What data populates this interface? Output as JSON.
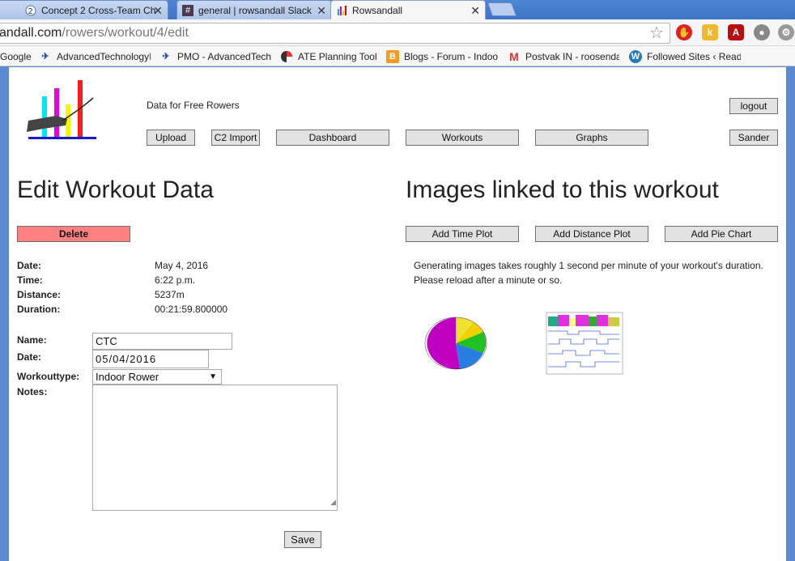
{
  "tabs": [
    {
      "label": "Concept 2 Cross-Team Ch",
      "icon": "concept2-icon",
      "active": false
    },
    {
      "label": "general | rowsandall Slack",
      "icon": "slack-icon",
      "active": false
    },
    {
      "label": "Rowsandall",
      "icon": "chart-favicon-icon",
      "active": true
    }
  ],
  "address": {
    "domain": "andall.com",
    "path": "/rowers/workout/4/edit"
  },
  "bookmarks": [
    {
      "label": "Google",
      "icon": "google-icon"
    },
    {
      "label": "AdvancedTechnologyI",
      "icon": "bookmark-app-icon"
    },
    {
      "label": "PMO - AdvancedTech",
      "icon": "bookmark-app-icon"
    },
    {
      "label": "ATE Planning Tool",
      "icon": "planning-icon"
    },
    {
      "label": "Blogs - Forum - Indoo",
      "icon": "blogger-icon"
    },
    {
      "label": "Postvak IN - roosenda",
      "icon": "gmail-icon"
    },
    {
      "label": "Followed Sites ‹ Read",
      "icon": "wordpress-icon"
    }
  ],
  "header": {
    "tagline": "Data for Free Rowers",
    "logout": "logout",
    "user": "Sander",
    "nav": {
      "upload": "Upload",
      "c2import": "C2 Import",
      "dashboard": "Dashboard",
      "workouts": "Workouts",
      "graphs": "Graphs"
    }
  },
  "edit": {
    "title": "Edit Workout Data",
    "delete": "Delete",
    "summary": [
      {
        "label": "Date:",
        "value": "May 4, 2016"
      },
      {
        "label": "Time:",
        "value": "6:22 p.m."
      },
      {
        "label": "Distance:",
        "value": "5237m"
      },
      {
        "label": "Duration:",
        "value": "00:21:59.800000"
      }
    ],
    "form": {
      "name_label": "Name:",
      "name_value": "CTC",
      "date_label": "Date:",
      "date_value": "05/04/2016",
      "type_label": "Workouttype:",
      "type_value": "Indoor Rower",
      "notes_label": "Notes:",
      "notes_value": ""
    },
    "save": "Save"
  },
  "images": {
    "title": "Images linked to this workout",
    "buttons": {
      "time": "Add Time Plot",
      "distance": "Add Distance Plot",
      "pie": "Add Pie Chart"
    },
    "note_line1": "Generating images takes roughly 1 second per minute of your workout's duration.",
    "note_line2": "Please reload after a minute or so.",
    "thumbnails": [
      "pie-chart-thumbnail",
      "time-plot-thumbnail"
    ]
  },
  "colors": {
    "delete_bg": "#ff8080",
    "logo_cyan": "#00e5ff",
    "logo_magenta": "#e600e6",
    "logo_yellow": "#f5f500",
    "logo_red": "#ff1a1a",
    "logo_blue": "#1a1acc"
  }
}
